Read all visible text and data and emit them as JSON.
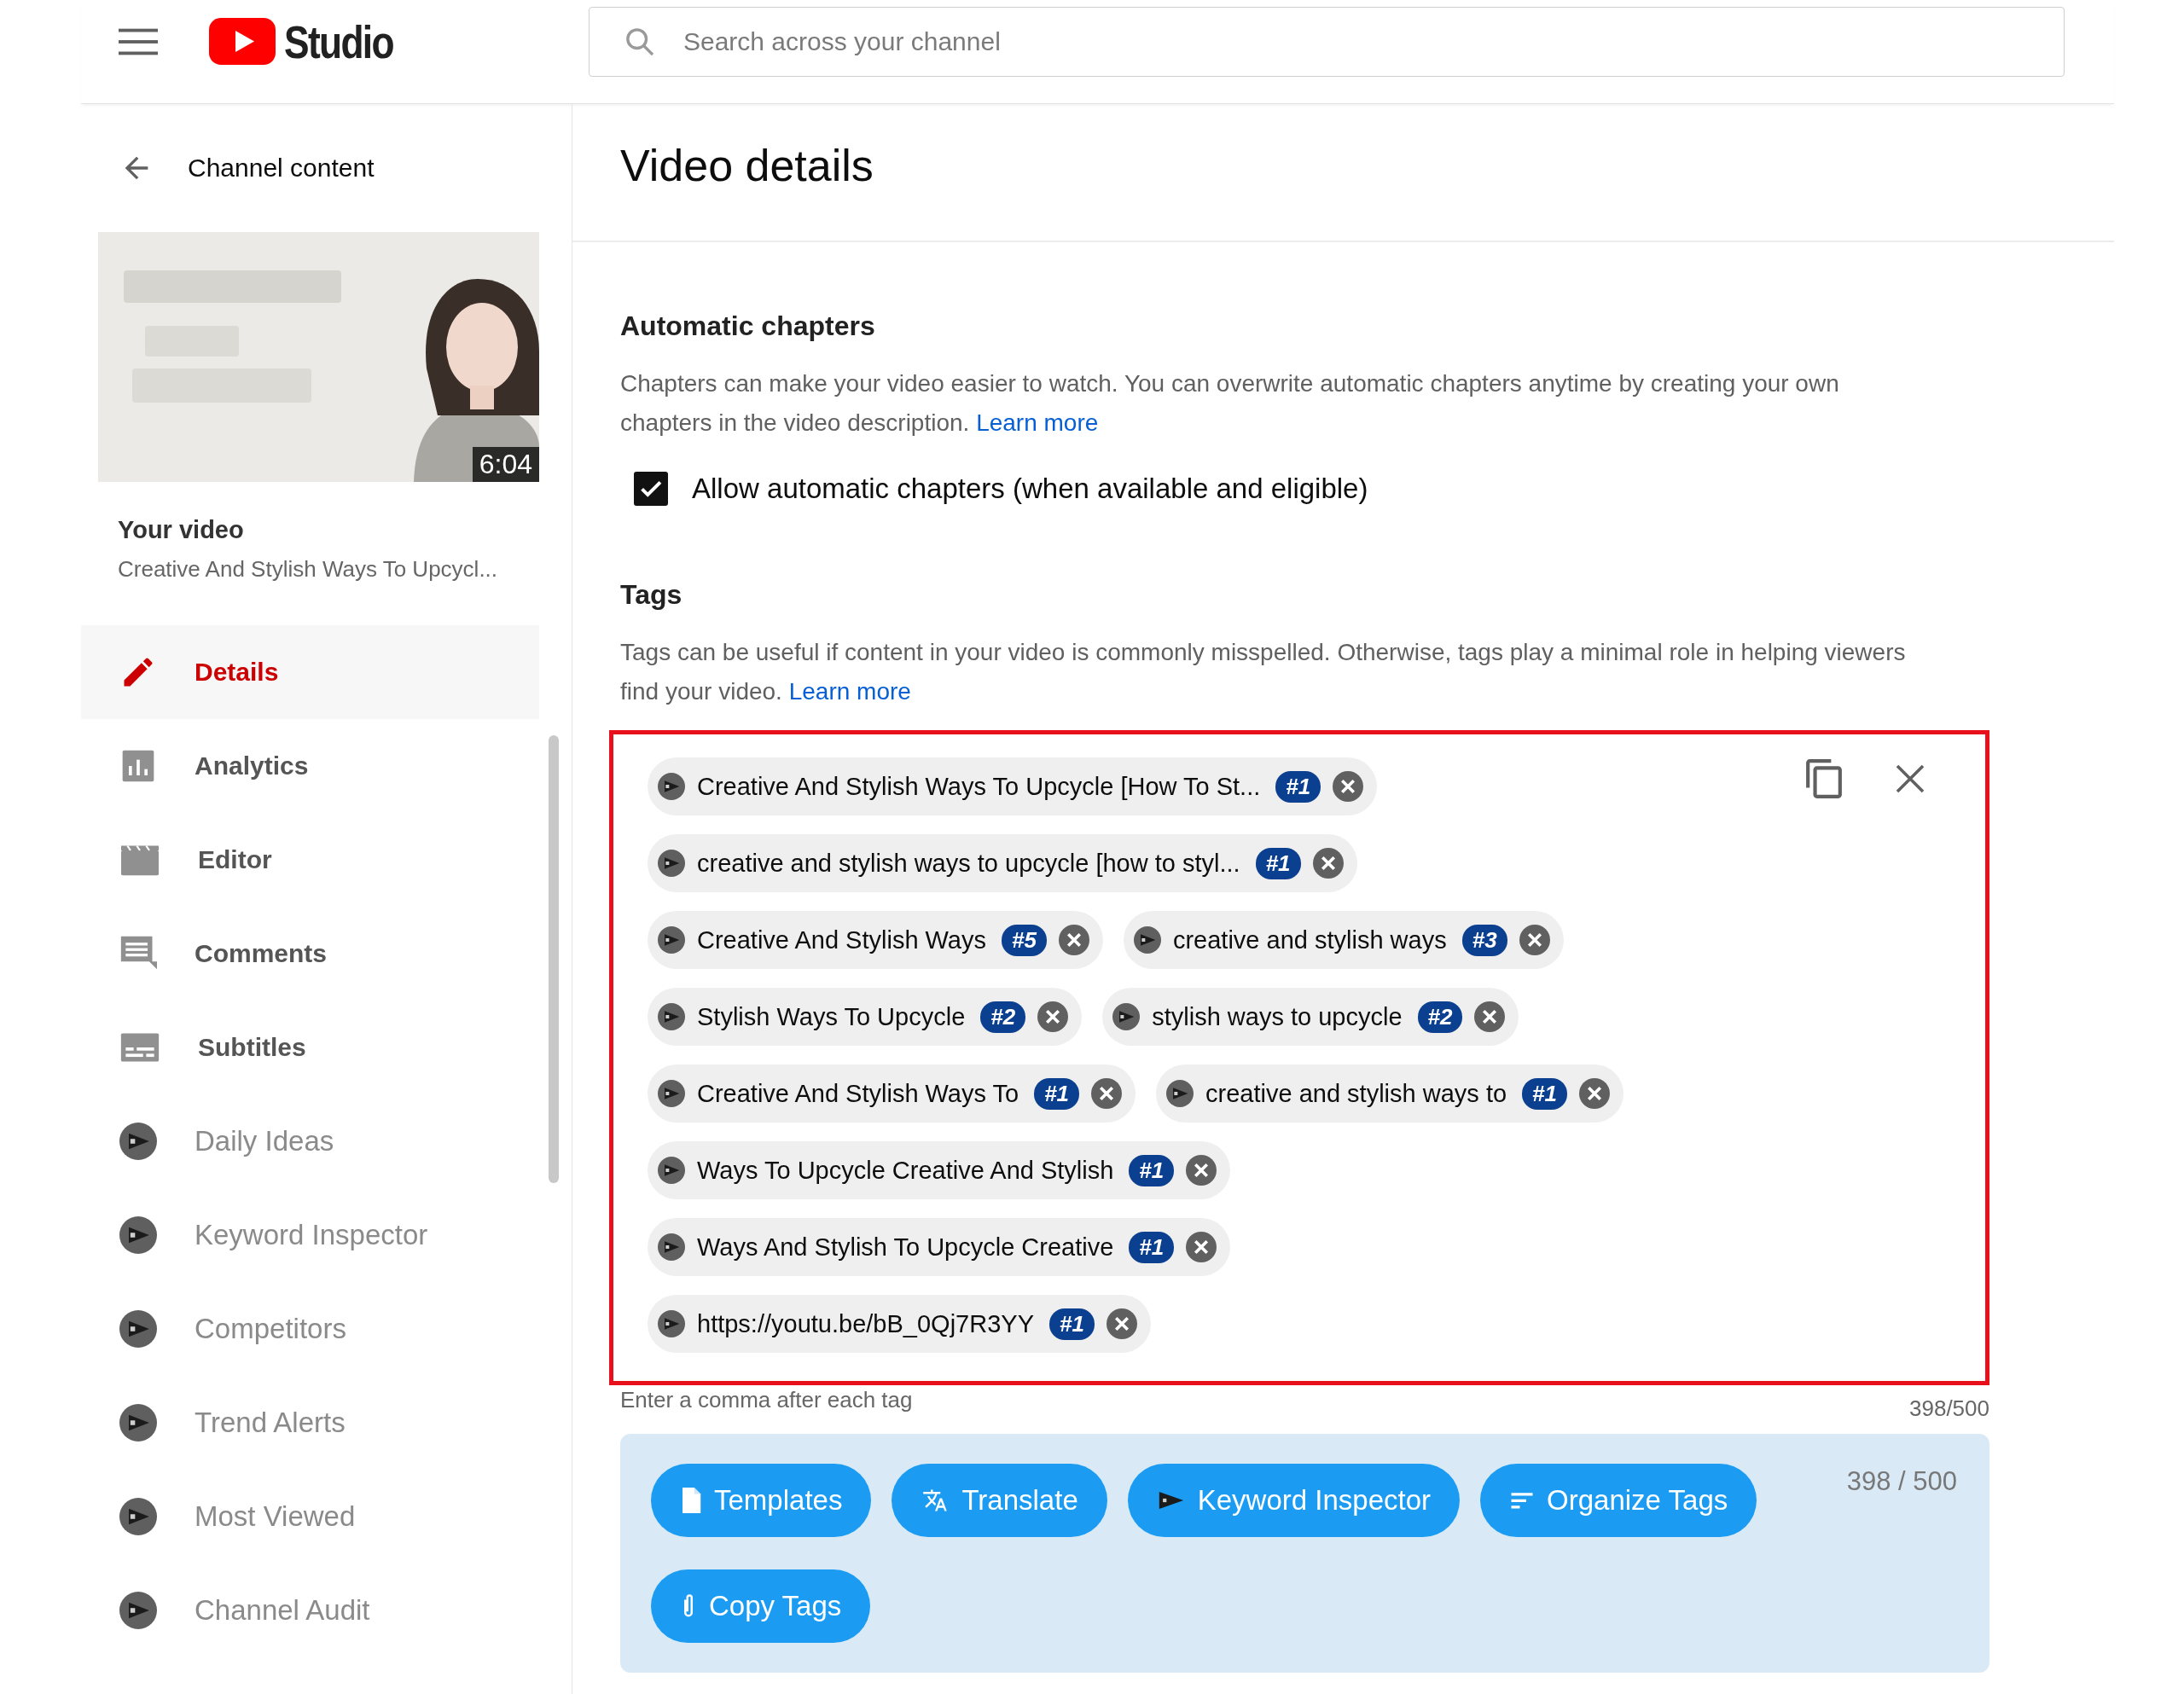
{
  "header": {
    "logo_text": "Studio",
    "search": {
      "placeholder": "Search across your channel"
    }
  },
  "sidebar": {
    "back_label": "Channel content",
    "video": {
      "kind": "picture",
      "duration": "6:04",
      "heading": "Your video",
      "title": "Creative And Stylish Ways To Upcycl..."
    },
    "items": [
      {
        "label": "Details",
        "kind": "studio",
        "selected": true
      },
      {
        "label": "Analytics",
        "kind": "studio",
        "selected": false
      },
      {
        "label": "Editor",
        "kind": "studio",
        "selected": false
      },
      {
        "label": "Comments",
        "kind": "studio",
        "selected": false
      },
      {
        "label": "Subtitles",
        "kind": "studio",
        "selected": false
      },
      {
        "label": "Daily Ideas",
        "kind": "extension",
        "selected": false
      },
      {
        "label": "Keyword Inspector",
        "kind": "extension",
        "selected": false
      },
      {
        "label": "Competitors",
        "kind": "extension",
        "selected": false
      },
      {
        "label": "Trend Alerts",
        "kind": "extension",
        "selected": false
      },
      {
        "label": "Most Viewed",
        "kind": "extension",
        "selected": false
      },
      {
        "label": "Channel Audit",
        "kind": "extension",
        "selected": false
      }
    ]
  },
  "main": {
    "title": "Video details",
    "chapters": {
      "heading": "Automatic chapters",
      "description": "Chapters can make your video easier to watch. You can overwrite automatic chapters anytime by creating your own chapters in the video description.",
      "link": "Learn more",
      "checkbox": {
        "label": "Allow automatic chapters (when available and eligible)",
        "checked": true
      }
    },
    "tags": {
      "heading": "Tags",
      "description": "Tags can be useful if content in your video is commonly misspelled. Otherwise, tags play a minimal role in helping viewers find your video.",
      "link": "Learn more",
      "rows": [
        [
          {
            "text": "Creative And Stylish Ways To Upcycle [How To St...",
            "rank": "#1"
          }
        ],
        [
          {
            "text": "creative and stylish ways to upcycle [how to styl...",
            "rank": "#1"
          }
        ],
        [
          {
            "text": "Creative And Stylish Ways",
            "rank": "#5"
          },
          {
            "text": "creative and stylish ways",
            "rank": "#3"
          }
        ],
        [
          {
            "text": "Stylish Ways To Upcycle",
            "rank": "#2"
          },
          {
            "text": "stylish ways to upcycle",
            "rank": "#2"
          }
        ],
        [
          {
            "text": "Creative And Stylish Ways To",
            "rank": "#1"
          },
          {
            "text": "creative and stylish ways to",
            "rank": "#1"
          }
        ],
        [
          {
            "text": "Ways To Upcycle Creative And Stylish",
            "rank": "#1"
          }
        ],
        [
          {
            "text": "Ways And Stylish To Upcycle Creative",
            "rank": "#1"
          }
        ],
        [
          {
            "text": "https://youtu.be/bB_0Qj7R3YY",
            "rank": "#1"
          }
        ]
      ],
      "hint": "Enter a comma after each tag",
      "count": "398/500",
      "toolbar": {
        "count": "398 / 500",
        "buttons": [
          {
            "label": "Templates",
            "kind": "document"
          },
          {
            "label": "Translate",
            "kind": "translate"
          },
          {
            "label": "Keyword Inspector",
            "kind": "extension"
          },
          {
            "label": "Organize Tags",
            "kind": "sort"
          },
          {
            "label": "Copy Tags",
            "kind": "clip"
          }
        ]
      }
    }
  }
}
